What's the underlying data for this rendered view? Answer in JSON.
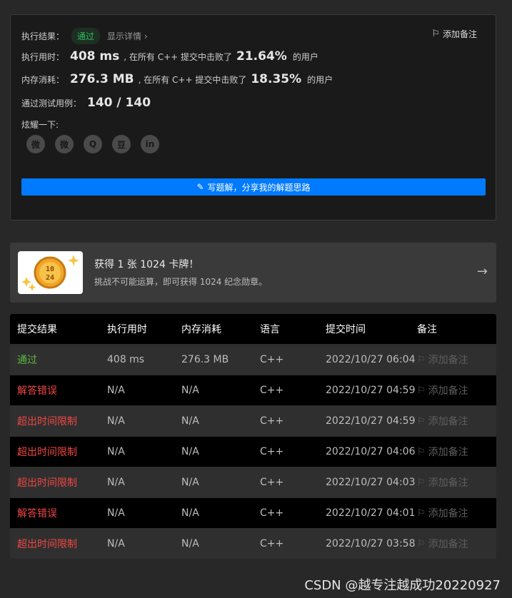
{
  "result": {
    "status_label": "执行结果：",
    "status_value": "通过",
    "details_link": "显示详情 ›",
    "add_note": "添加备注",
    "runtime": {
      "label": "执行用时：",
      "value": "408 ms",
      "middle": ", 在所有 C++ 提交中击败了",
      "percent": "21.64%",
      "tail": "的用户"
    },
    "memory": {
      "label": "内存消耗：",
      "value": "276.3 MB",
      "middle": ", 在所有 C++ 提交中击败了",
      "percent": "18.35%",
      "tail": "的用户"
    },
    "tests": {
      "label": "通过测试用例：",
      "value": "140 / 140"
    },
    "share_label": "炫耀一下:",
    "share_icons": [
      "wechat-icon",
      "weibo-icon",
      "qq-icon",
      "douban-icon",
      "linkedin-icon"
    ],
    "share_glyphs": [
      "微",
      "微",
      "Q",
      "豆",
      "in"
    ],
    "write_button": "写题解，分享我的解题思路"
  },
  "badge": {
    "image_text_top": "10",
    "image_text_bottom": "24",
    "title": "获得 1 张 1024 卡牌！",
    "subtitle": "挑战不可能运算，即可获得 1024 纪念勋章。",
    "arrow": "→"
  },
  "table": {
    "headers": [
      "提交结果",
      "执行用时",
      "内存消耗",
      "语言",
      "提交时间",
      "备注"
    ],
    "rows": [
      {
        "result": "通过",
        "status": "ok",
        "time": "408 ms",
        "memory": "276.3 MB",
        "lang": "C++",
        "submitted": "2022/10/27 06:04",
        "note": "添加备注"
      },
      {
        "result": "解答错误",
        "status": "bad",
        "time": "N/A",
        "memory": "N/A",
        "lang": "C++",
        "submitted": "2022/10/27 04:59",
        "note": "添加备注"
      },
      {
        "result": "超出时间限制",
        "status": "bad",
        "time": "N/A",
        "memory": "N/A",
        "lang": "C++",
        "submitted": "2022/10/27 04:59",
        "note": "添加备注"
      },
      {
        "result": "超出时间限制",
        "status": "bad",
        "time": "N/A",
        "memory": "N/A",
        "lang": "C++",
        "submitted": "2022/10/27 04:06",
        "note": "添加备注"
      },
      {
        "result": "超出时间限制",
        "status": "bad",
        "time": "N/A",
        "memory": "N/A",
        "lang": "C++",
        "submitted": "2022/10/27 04:03",
        "note": "添加备注"
      },
      {
        "result": "解答错误",
        "status": "bad",
        "time": "N/A",
        "memory": "N/A",
        "lang": "C++",
        "submitted": "2022/10/27 04:01",
        "note": "添加备注"
      },
      {
        "result": "超出时间限制",
        "status": "bad",
        "time": "N/A",
        "memory": "N/A",
        "lang": "C++",
        "submitted": "2022/10/27 03:58",
        "note": "添加备注"
      }
    ]
  },
  "watermark": "CSDN @越专注越成功20220927",
  "colors": {
    "accepted": "#5cb83f",
    "error": "#ef4743",
    "primary_button": "#007aff"
  }
}
